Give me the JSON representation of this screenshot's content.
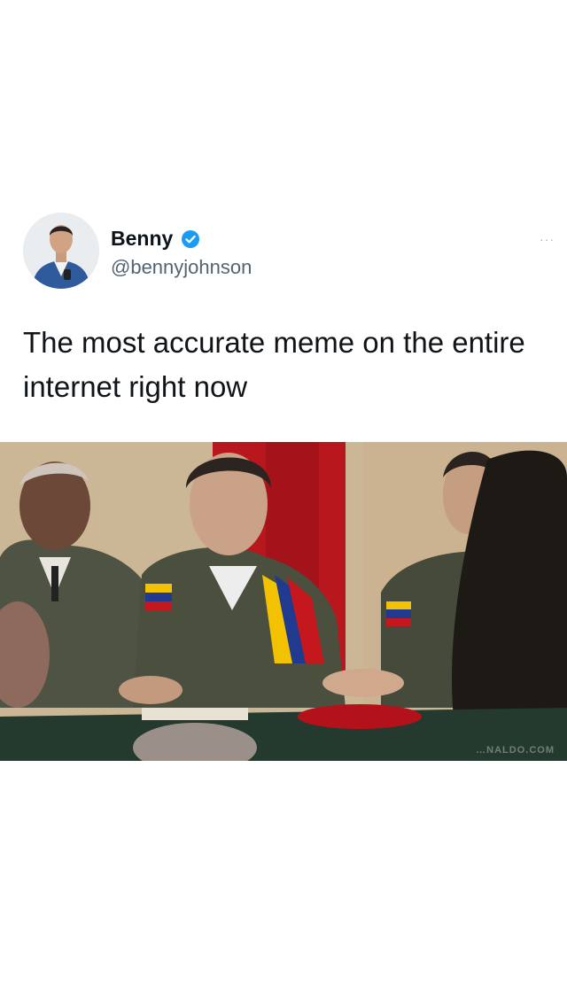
{
  "tweet": {
    "author": {
      "display_name": "Benny",
      "handle": "@bennyjohnson",
      "verified": true,
      "avatar_icon": "avatar-photo"
    },
    "menu_icon": "more-options-icon",
    "more_label": "···",
    "text": "The most accurate meme on the entire internet right now"
  },
  "media": {
    "type": "video-frame",
    "watermark": "…NALDO.COM"
  },
  "colors": {
    "verified": "#1d9bf0",
    "text": "#0f1419",
    "handle": "#536471"
  }
}
